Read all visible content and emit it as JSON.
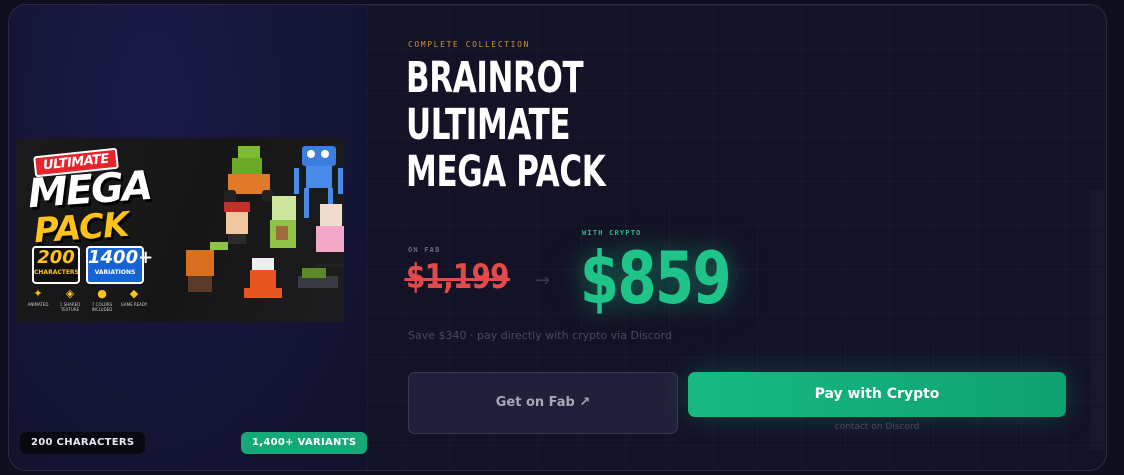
{
  "product": {
    "eyebrow": "COMPLETE COLLECTION",
    "title_lines": [
      "BRAINROT",
      "ULTIMATE",
      "MEGA PACK"
    ],
    "image": {
      "ultimate": "ULTIMATE",
      "mega": "MEGA",
      "pack": "PACK",
      "characters_count": "200",
      "characters_label": "CHARACTERS",
      "variations_count": "1400+",
      "variations_label": "VARIATIONS",
      "features": [
        {
          "icon": "running-icon",
          "label": "ANIMATED"
        },
        {
          "icon": "cube-icon",
          "label": "1 SHARED TEXTURE"
        },
        {
          "icon": "palette-icon",
          "label": "7 COLORS INCLUDED"
        },
        {
          "icon": "gamepad-icon",
          "label": "GAME READY"
        }
      ]
    },
    "badges": {
      "characters": "200 CHARACTERS",
      "variants": "1,400+ VARIANTS"
    }
  },
  "pricing": {
    "fab_label": "ON FAB",
    "fab_price": "$1,199",
    "arrow": "→",
    "crypto_label": "WITH CRYPTO",
    "crypto_price": "$859",
    "save_note": "Save $340 · pay directly with crypto via Discord"
  },
  "actions": {
    "fab_button": "Get on Fab ↗",
    "crypto_button": "Pay with Crypto",
    "contact_note": "contact on Discord"
  },
  "colors": {
    "background": "#0f0e1e",
    "accent_green": "#1fc489",
    "old_price_red": "#e34a4a",
    "eyebrow_gold": "#c9923a"
  }
}
